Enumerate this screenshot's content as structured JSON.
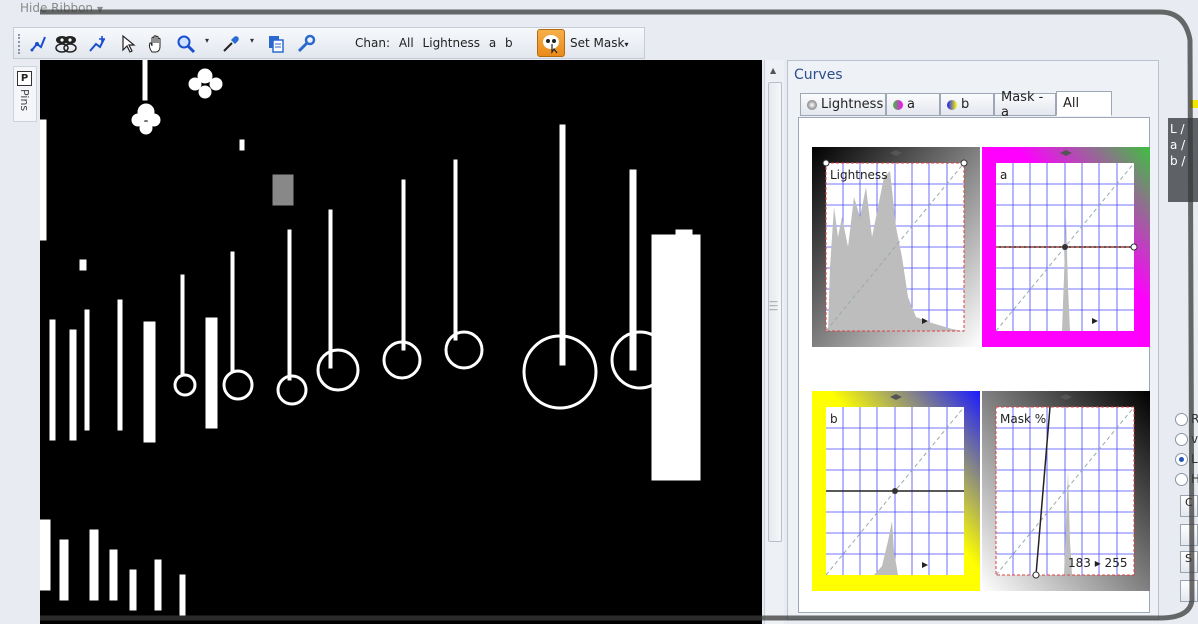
{
  "ribbon": {
    "toggle_label": "Hide Ribbon"
  },
  "toolbar": {
    "tools": [
      "curve-tool-icon",
      "mask-tool-icon",
      "add-point-icon",
      "pointer-icon",
      "hand-icon",
      "zoom-icon",
      "eyedropper-icon",
      "copy-icon",
      "wrench-icon"
    ],
    "chan_label": "Chan:",
    "channels": [
      "All",
      "Lightness",
      "a",
      "b"
    ],
    "set_mask_label": "Set Mask"
  },
  "pins": {
    "box": "P",
    "label": "Pins"
  },
  "curves": {
    "title": "Curves",
    "tabs": [
      "Lightness",
      "a",
      "b",
      "Mask - a",
      "All"
    ],
    "active_tab": "All",
    "graphs": [
      {
        "label": "Lightness",
        "channel": "lightness"
      },
      {
        "label": "a",
        "channel": "a"
      },
      {
        "label": "b",
        "channel": "b"
      },
      {
        "label": "Mask %",
        "channel": "mask",
        "readout": "183 ▸ 255"
      }
    ]
  },
  "right_strip": {
    "lab": [
      "L /",
      "a /",
      "b /"
    ],
    "radio_labels": [
      "R",
      "v",
      "L",
      "H"
    ],
    "buttons": [
      "C",
      "",
      "S",
      ""
    ]
  },
  "colors": {
    "accent": "#2c4f8a",
    "magenta": "#ff00ff",
    "green": "#3fbf3f",
    "yellow": "#ffff00",
    "blue": "#1a1aff",
    "gridline": "#4a4aff"
  }
}
